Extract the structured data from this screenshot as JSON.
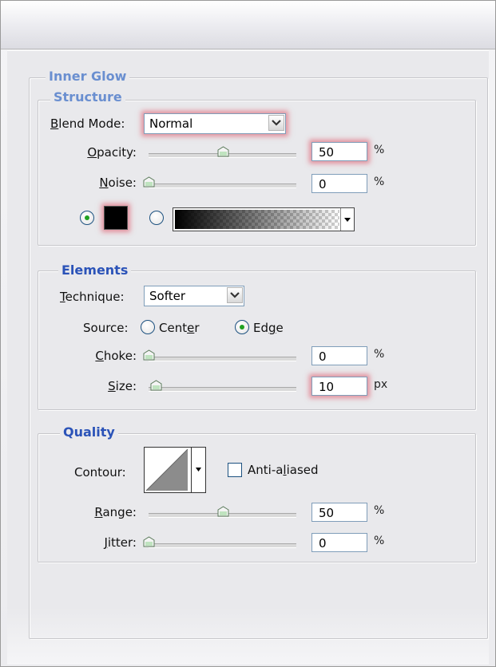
{
  "colors": {
    "legend_primary": "#6a8fd0",
    "legend_section": "#2b53b8",
    "glow": "#e06070",
    "radio_dot": "#21a121"
  },
  "main_legend": "Inner Glow",
  "structure": {
    "legend": "Structure",
    "blend_mode_label": "Blend Mode:",
    "blend_mode_value": "Normal",
    "opacity_label": "Opacity:",
    "opacity_value": "50",
    "opacity_unit": "%",
    "opacity_slider_fraction": 0.5,
    "noise_label": "Noise:",
    "noise_value": "0",
    "noise_unit": "%",
    "noise_slider_fraction": 0.0,
    "color_swatch": "#000000",
    "selected_fill": "color"
  },
  "elements": {
    "legend": "Elements",
    "technique_label": "Technique:",
    "technique_value": "Softer",
    "source_label": "Source:",
    "source_center": "Center",
    "source_edge": "Edge",
    "source_selected": "Edge",
    "choke_label": "Choke:",
    "choke_value": "0",
    "choke_unit": "%",
    "choke_slider_fraction": 0.0,
    "size_label": "Size:",
    "size_value": "10",
    "size_unit": "px",
    "size_slider_fraction": 0.05
  },
  "quality": {
    "legend": "Quality",
    "contour_label": "Contour:",
    "anti_aliased_label": "Anti-aliased",
    "anti_aliased_checked": false,
    "range_label": "Range:",
    "range_value": "50",
    "range_unit": "%",
    "range_slider_fraction": 0.5,
    "jitter_label": "Jitter:",
    "jitter_value": "0",
    "jitter_unit": "%",
    "jitter_slider_fraction": 0.0
  }
}
